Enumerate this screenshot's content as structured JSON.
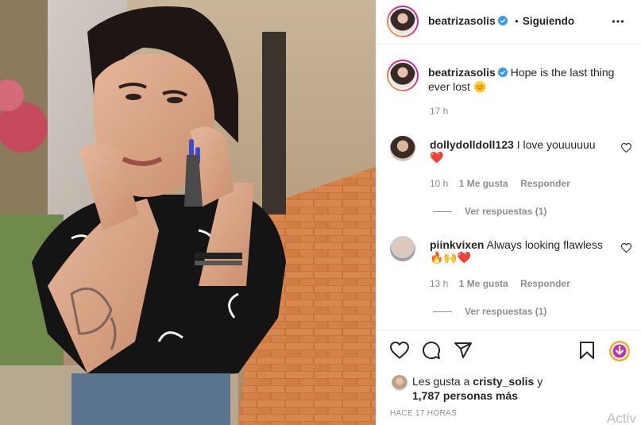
{
  "post": {
    "username": "beatrizasolis",
    "follow_separator": "•",
    "follow_status": "Siguiendo",
    "caption": {
      "username": "beatrizasolis",
      "text_line1": "Hope is the last thing",
      "text_line2": "ever lost",
      "emoji": "🌞",
      "time": "17 h"
    }
  },
  "comments": [
    {
      "username": "dollydolldoll123",
      "text": "I love youuuuuu",
      "emoji": "❤️",
      "time": "10 h",
      "likes": "1 Me gusta",
      "reply": "Responder",
      "view_replies": "Ver respuestas (1)"
    },
    {
      "username": "piinkvixen",
      "text": "Always looking flawless",
      "emoji": "🔥🙌❤️",
      "time": "13 h",
      "likes": "1 Me gusta",
      "reply": "Responder",
      "view_replies": "Ver respuestas (1)"
    }
  ],
  "likes": {
    "prefix": "Les gusta a",
    "user": "cristy_solis",
    "suffix": "y",
    "count": "1,787 personas más"
  },
  "post_time": "HACE 17 HORAS",
  "watermark": "Activ",
  "colors": {
    "verified": "#3897f0",
    "heart_red": "#ed4956",
    "text": "#262626",
    "muted": "#8e8e8e"
  },
  "icons": [
    "more-options-icon",
    "heart-icon",
    "comment-icon",
    "share-icon",
    "save-icon",
    "download-icon",
    "verified-badge-icon"
  ]
}
